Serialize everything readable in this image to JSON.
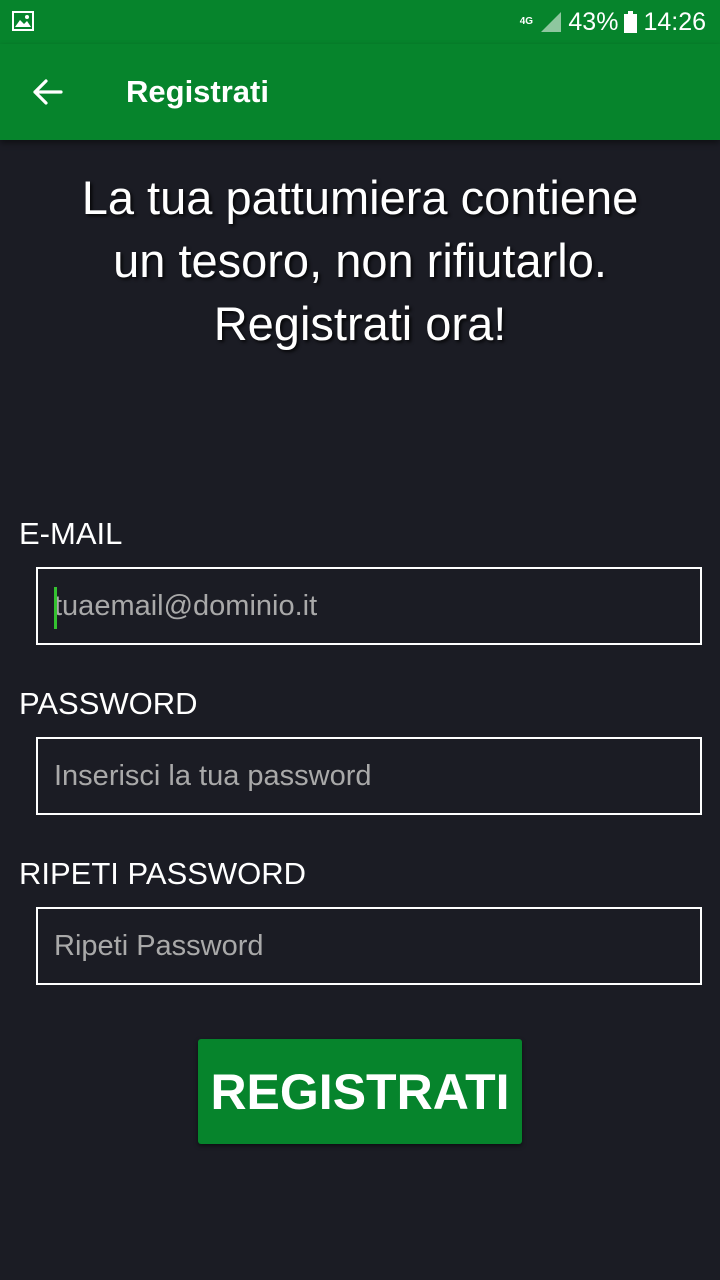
{
  "status_bar": {
    "network": "4G",
    "battery": "43%",
    "time": "14:26",
    "icons": [
      "gallery-icon",
      "signal-icon",
      "battery-icon"
    ]
  },
  "app_bar": {
    "back_icon": "arrow-left-icon",
    "title": "Registrati"
  },
  "headline": {
    "lines": [
      "La tua pattumiera contiene",
      "un tesoro, non rifiutarlo.",
      "Registrati ora!"
    ]
  },
  "form": {
    "email": {
      "label": "E-MAIL",
      "value": "",
      "placeholder": "tuaemail@dominio.it"
    },
    "password": {
      "label": "PASSWORD",
      "value": "",
      "placeholder": "Inserisci la tua password"
    },
    "repeat_password": {
      "label": "RIPETI PASSWORD",
      "value": "",
      "placeholder": "Ripeti Password"
    },
    "submit_label": "REGISTRATI"
  },
  "colors": {
    "primary": "#06842c",
    "background": "#1b1c24",
    "text": "#ffffff",
    "placeholder": "#a9a9a9",
    "cursor": "#34c230"
  }
}
